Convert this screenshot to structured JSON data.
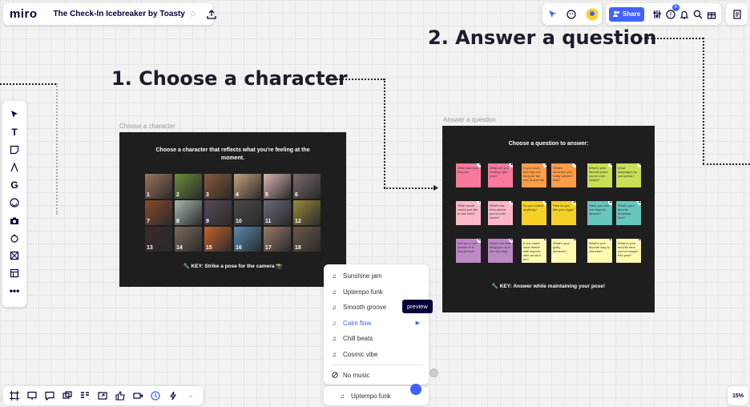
{
  "app": {
    "logo": "miro",
    "board_title": "The Check-In Icebreaker by Toasty",
    "star": "☆"
  },
  "header": {
    "share_label": "Share",
    "notifications_badge": "3"
  },
  "canvas": {
    "step1_heading": "1.  Choose a character",
    "step2_heading": "2. Answer a question",
    "frame1": {
      "label": "Choose a character",
      "title": "Choose a character that reflects what you're feeling at the moment.",
      "key": "🔧 KEY: Strike a pose for the camera 📸",
      "characters": [
        {
          "num": "1",
          "color": "#a0745a"
        },
        {
          "num": "2",
          "color": "#6b8f3a"
        },
        {
          "num": "3",
          "color": "#8a5a3a"
        },
        {
          "num": "4",
          "color": "#c9a27c"
        },
        {
          "num": "5",
          "color": "#d8b4b0"
        },
        {
          "num": "6",
          "color": "#7a6a6a"
        },
        {
          "num": "7",
          "color": "#8a4a2a"
        },
        {
          "num": "8",
          "color": "#a8b8b0"
        },
        {
          "num": "9",
          "color": "#5a4a5a"
        },
        {
          "num": "10",
          "color": "#4a4a4a"
        },
        {
          "num": "11",
          "color": "#6a6a7a"
        },
        {
          "num": "12",
          "color": "#9a8a3a"
        },
        {
          "num": "13",
          "color": "#3a2a2a"
        },
        {
          "num": "14",
          "color": "#7a6a5a"
        },
        {
          "num": "15",
          "color": "#c8642a"
        },
        {
          "num": "16",
          "color": "#5a8ab0"
        },
        {
          "num": "17",
          "color": "#9a7a6a"
        },
        {
          "num": "18",
          "color": "#6a5a4a"
        }
      ]
    },
    "frame2": {
      "label": "Answer a question",
      "title": "Choose a question to answer:",
      "key": "🔧 KEY: Answer while maintaining your pose!",
      "notes": [
        {
          "num": "1",
          "text": "What was your first job?",
          "color": "#f77a9e"
        },
        {
          "num": "2",
          "text": "What are you reading right now?",
          "color": "#f77a9e"
        },
        {
          "num": "3",
          "text": "If you could eat only one thing for the rest of your life",
          "color": "#ff9d48"
        },
        {
          "num": "4",
          "text": "What's someone you really admire? why?",
          "color": "#ff9d48"
        },
        {
          "num": "5",
          "text": "What's your favorite place you've ever visited?",
          "color": "#c9df56"
        },
        {
          "num": "6",
          "text": "What languages do you speak?",
          "color": "#c9df56"
        },
        {
          "num": "7",
          "text": "What secret would you like to see next?",
          "color": "#fbb8c9"
        },
        {
          "num": "8",
          "text": "What's the best advice you've ever heard?",
          "color": "#fbb8c9"
        },
        {
          "num": "9",
          "text": "Do you collect anything?",
          "color": "#f5d128"
        },
        {
          "num": "10",
          "text": "How do you like your eggs?",
          "color": "#f5d128"
        },
        {
          "num": "11",
          "text": "Have you ever met anyone famous?",
          "color": "#67c6c0"
        },
        {
          "num": "12",
          "text": "What's your favorite breakfast food?",
          "color": "#67c6c0"
        },
        {
          "num": "13",
          "text": "Are you a cat person or a dog person?",
          "color": "#be88c7"
        },
        {
          "num": "14",
          "text": "What's the first thing you do in the morning?",
          "color": "#be88c7"
        },
        {
          "num": "15",
          "text": "If you could have dinner with anyone, who would it be?",
          "color": "#fff9b1"
        },
        {
          "num": "16",
          "text": "What's your guilty pleasure?",
          "color": "#fff9b1"
        },
        {
          "num": "17",
          "text": "What's your favorite way to exercise?",
          "color": "#fff9b1"
        },
        {
          "num": "18",
          "text": "What is your favorite item you've bought this year?",
          "color": "#fff9b1"
        }
      ]
    }
  },
  "music": {
    "items": [
      "Sunshine jam",
      "Uptempo funk",
      "Smooth groove",
      "Calm flow",
      "Chill beats",
      "Cosmic vibe"
    ],
    "no_music": "No music",
    "tooltip": "preview",
    "now_playing": "Uptempo funk"
  },
  "zoom": "15%"
}
